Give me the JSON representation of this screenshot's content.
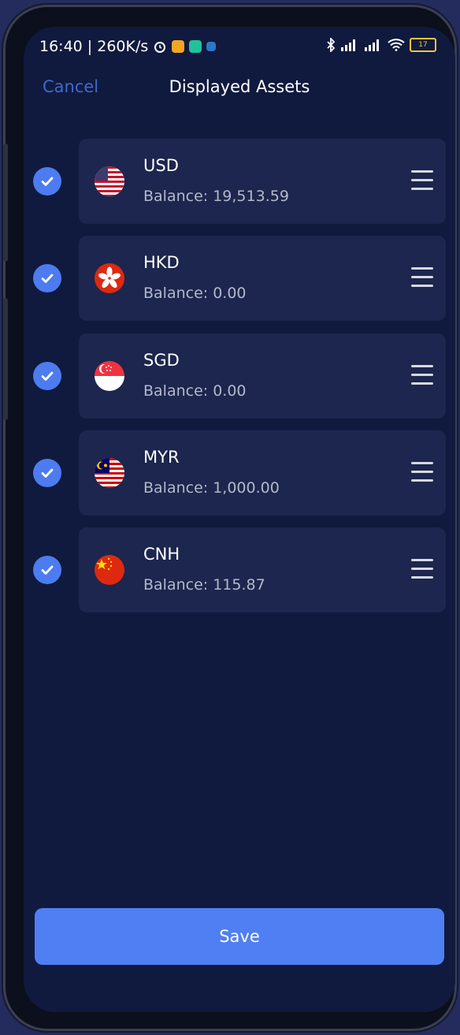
{
  "status_bar": {
    "time_speed": "16:40 | 260K/s",
    "battery": "17"
  },
  "nav": {
    "cancel_label": "Cancel",
    "title": "Displayed Assets"
  },
  "assets": [
    {
      "code": "USD",
      "balance": "Balance: 19,513.59",
      "checked": true,
      "flag": "us-flag-icon"
    },
    {
      "code": "HKD",
      "balance": "Balance: 0.00",
      "checked": true,
      "flag": "hk-flag-icon"
    },
    {
      "code": "SGD",
      "balance": "Balance: 0.00",
      "checked": true,
      "flag": "sg-flag-icon"
    },
    {
      "code": "MYR",
      "balance": "Balance: 1,000.00",
      "checked": true,
      "flag": "my-flag-icon"
    },
    {
      "code": "CNH",
      "balance": "Balance: 115.87",
      "checked": true,
      "flag": "cn-flag-icon"
    }
  ],
  "save_label": "Save",
  "colors": {
    "accent": "#4f7ff2",
    "background": "#101a3e",
    "card": "#1c264e",
    "cancel": "#3f68cf"
  }
}
